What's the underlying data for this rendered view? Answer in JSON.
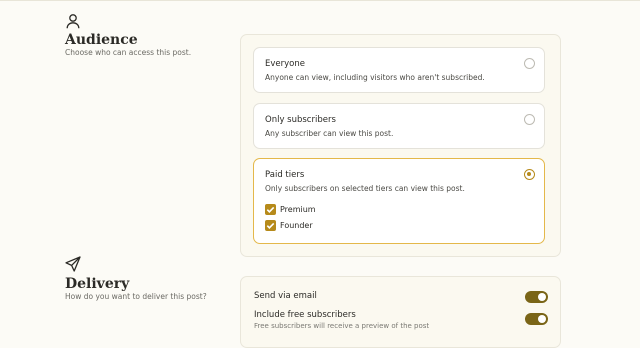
{
  "audience": {
    "icon": "person-icon",
    "title": "Audience",
    "subtitle": "Choose who can access this post.",
    "options": [
      {
        "title": "Everyone",
        "description": "Anyone can view, including visitors who aren't subscribed.",
        "selected": false
      },
      {
        "title": "Only subscribers",
        "description": "Any subscriber can view this post.",
        "selected": false
      },
      {
        "title": "Paid tiers",
        "description": "Only subscribers on selected tiers can view this post.",
        "selected": true
      }
    ],
    "tiers": [
      {
        "label": "Premium",
        "checked": true
      },
      {
        "label": "Founder",
        "checked": true
      }
    ]
  },
  "delivery": {
    "icon": "send-icon",
    "title": "Delivery",
    "subtitle": "How do you want to deliver this post?",
    "send_via_email": {
      "label": "Send via email",
      "enabled": true
    },
    "include_free": {
      "label": "Include free subscribers",
      "hint": "Free subscribers will receive a preview of the post",
      "enabled": true
    }
  },
  "colors": {
    "accent": "#b68a1a",
    "toggle_on": "#7a6517",
    "selected_border": "#e4b84a",
    "background": "#fcfbf6"
  }
}
